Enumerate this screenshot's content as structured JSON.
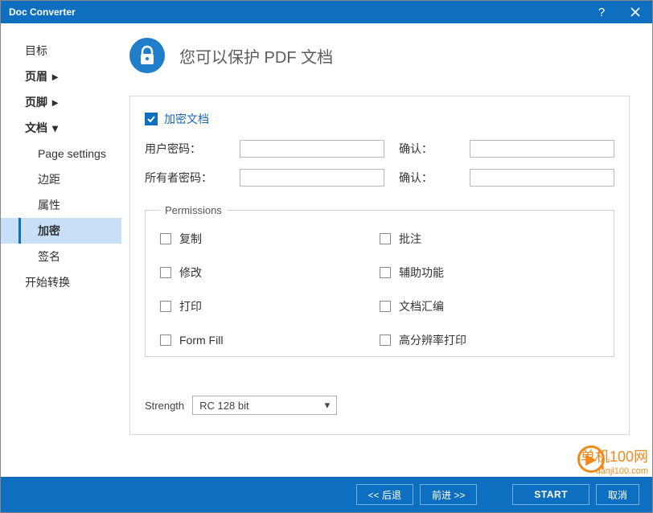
{
  "titlebar": {
    "title": "Doc Converter"
  },
  "sidebar": {
    "target": "目标",
    "header": "页眉",
    "footer": "页脚",
    "document": "文档",
    "sub": {
      "page_settings": "Page settings",
      "margins": "边距",
      "properties": "属性",
      "encrypt": "加密",
      "sign": "签名"
    },
    "start_convert": "开始转换"
  },
  "main": {
    "title": "您可以保护 PDF 文档",
    "encrypt_doc": "加密文档",
    "user_pw": "用户密码：",
    "owner_pw": "所有者密码：",
    "confirm": "确认：",
    "permissions_legend": "Permissions",
    "perm": {
      "copy": "复制",
      "annotate": "批注",
      "modify": "修改",
      "accessibility": "辅助功能",
      "print": "打印",
      "assemble": "文档汇编",
      "form_fill": "Form Fill",
      "hires_print": "高分辨率打印"
    },
    "strength_label": "Strength",
    "strength_value": "RC 128 bit"
  },
  "footer": {
    "back": "<<  后退",
    "forward": "前进  >>",
    "start": "START",
    "cancel": "取消"
  },
  "watermark": {
    "main": "单机100网",
    "sub": "danji100.com"
  }
}
